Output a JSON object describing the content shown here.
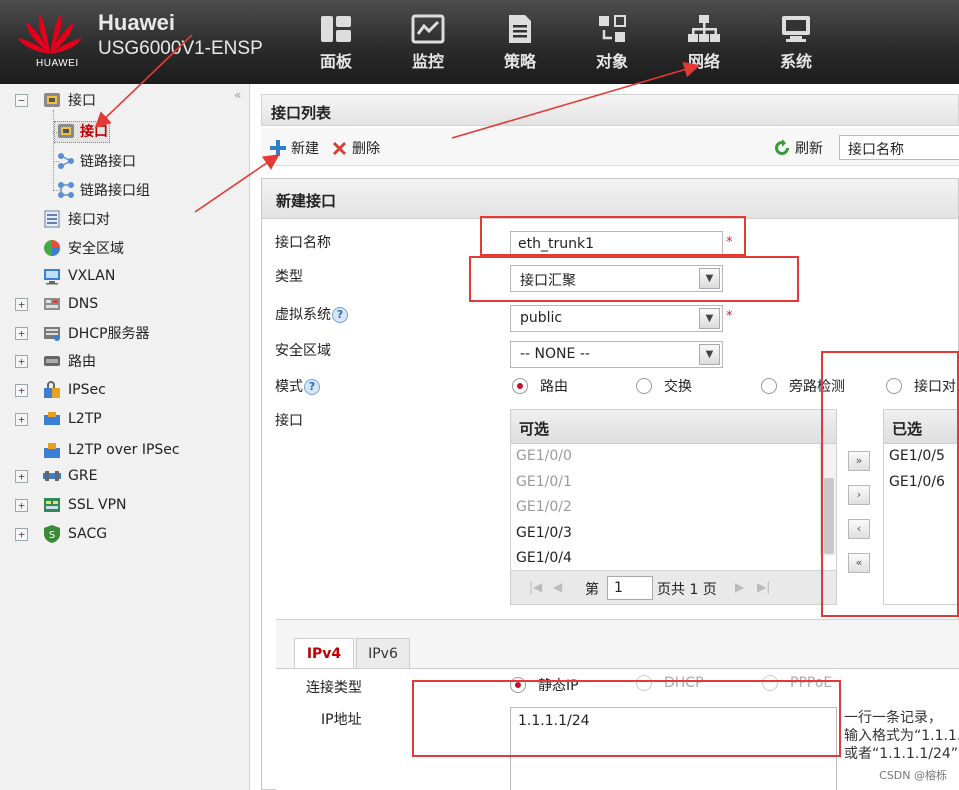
{
  "header": {
    "logo_text": "HUAWEI",
    "brand": "Huawei",
    "model": "USG6000V1-ENSP",
    "nav": [
      {
        "label": "面板",
        "icon": "dashboard-icon"
      },
      {
        "label": "监控",
        "icon": "monitor-icon"
      },
      {
        "label": "策略",
        "icon": "policy-icon"
      },
      {
        "label": "对象",
        "icon": "object-icon"
      },
      {
        "label": "网络",
        "icon": "network-icon"
      },
      {
        "label": "系统",
        "icon": "system-icon"
      }
    ]
  },
  "sidebar": {
    "collapse_glyph": "«",
    "items": [
      {
        "label": "接口",
        "expander": "−",
        "icon": "interface-icon"
      },
      {
        "label": "接口",
        "icon": "interface-icon",
        "selected": true
      },
      {
        "label": "链路接口",
        "icon": "link-interface-icon"
      },
      {
        "label": "链路接口组",
        "icon": "link-group-icon"
      },
      {
        "label": "接口对",
        "icon": "interface-pair-icon"
      },
      {
        "label": "安全区域",
        "icon": "security-zone-icon"
      },
      {
        "label": "VXLAN",
        "icon": "vxlan-icon"
      },
      {
        "label": "DNS",
        "expander": "+",
        "icon": "dns-icon"
      },
      {
        "label": "DHCP服务器",
        "expander": "+",
        "icon": "dhcp-icon"
      },
      {
        "label": "路由",
        "expander": "+",
        "icon": "route-icon"
      },
      {
        "label": "IPSec",
        "expander": "+",
        "icon": "ipsec-icon"
      },
      {
        "label": "L2TP",
        "expander": "+",
        "icon": "l2tp-icon"
      },
      {
        "label": "L2TP over IPSec",
        "icon": "l2tp-ipsec-icon"
      },
      {
        "label": "GRE",
        "expander": "+",
        "icon": "gre-icon"
      },
      {
        "label": "SSL VPN",
        "expander": "+",
        "icon": "sslvpn-icon"
      },
      {
        "label": "SACG",
        "expander": "+",
        "icon": "sacg-icon"
      }
    ]
  },
  "panel": {
    "title": "接口列表",
    "new_label": "新建",
    "delete_label": "删除",
    "refresh_label": "刷新",
    "filter_value": "接口名称"
  },
  "dialog": {
    "title": "新建接口",
    "name_label": "接口名称",
    "name_value": "eth_trunk1",
    "type_label": "类型",
    "type_value": "接口汇聚",
    "vsys_label": "虚拟系统",
    "vsys_value": "public",
    "zone_label": "安全区域",
    "zone_value": "-- NONE --",
    "mode_label": "模式",
    "modes": [
      {
        "label": "路由",
        "checked": true
      },
      {
        "label": "交换",
        "checked": false
      },
      {
        "label": "旁路检测",
        "checked": false
      },
      {
        "label": "接口对",
        "checked": false
      }
    ],
    "interface_label": "接口",
    "required_mark": "*",
    "help_glyph": "?"
  },
  "interface_picker": {
    "available_title": "可选",
    "available": [
      "GE1/0/0",
      "GE1/0/1",
      "GE1/0/2",
      "GE1/0/3",
      "GE1/0/4"
    ],
    "available_disabled": [
      true,
      true,
      true,
      false,
      false
    ],
    "selected_title": "已选",
    "selected": [
      "GE1/0/5",
      "GE1/0/6"
    ],
    "pager": {
      "prefix": "第",
      "page": "1",
      "suffix": "页共 1 页"
    },
    "buttons": {
      "add_all": "»",
      "add": "›",
      "remove": "‹",
      "remove_all": "«"
    }
  },
  "ip": {
    "tabs": [
      "IPv4",
      "IPv6"
    ],
    "conn_type_label": "连接类型",
    "conn_types": [
      {
        "label": "静态IP",
        "checked": true
      },
      {
        "label": "DHCP",
        "checked": false
      },
      {
        "label": "PPPoE",
        "checked": false
      }
    ],
    "ip_label": "IP地址",
    "ip_value": "1.1.1.1/24",
    "note_lines": [
      "一行一条记录，",
      "输入格式为“1.1.1.",
      "或者“1.1.1.1/24”"
    ]
  },
  "watermark": "CSDN @榕栎",
  "annotation_color": "#e53935"
}
